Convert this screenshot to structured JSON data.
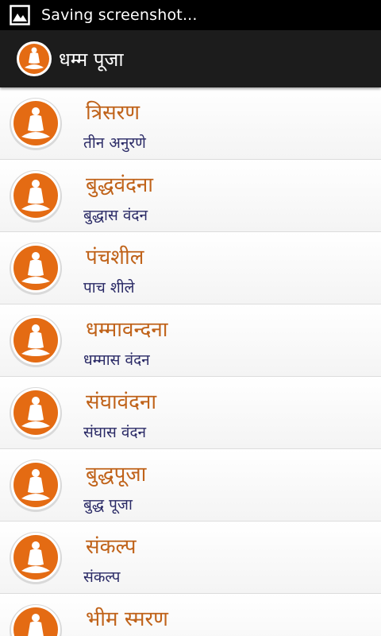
{
  "status_bar": {
    "icon": "image-icon",
    "text": "Saving screenshot..."
  },
  "action_bar": {
    "icon": "buddha-icon",
    "title": "धम्म पूजा"
  },
  "colors": {
    "title": "#c0631a",
    "subtitle": "#2a2a66",
    "icon_orange": "#e46b13",
    "action_bar": "#1c1c1c"
  },
  "items": [
    {
      "title": "त्रिसरण",
      "subtitle": "तीन अनुरणे"
    },
    {
      "title": "बुद्धवंदना",
      "subtitle": "बुद्धास वंदन"
    },
    {
      "title": "पंचशील",
      "subtitle": "पाच शीले"
    },
    {
      "title": "धम्मावन्दना",
      "subtitle": "धम्मास वंदन"
    },
    {
      "title": "संघावंदना",
      "subtitle": "संघास वंदन"
    },
    {
      "title": "बुद्धपूजा",
      "subtitle": "बुद्ध पूजा"
    },
    {
      "title": "संकल्प",
      "subtitle": "संकल्प"
    },
    {
      "title": "भीम स्मरण",
      "subtitle": ""
    }
  ]
}
